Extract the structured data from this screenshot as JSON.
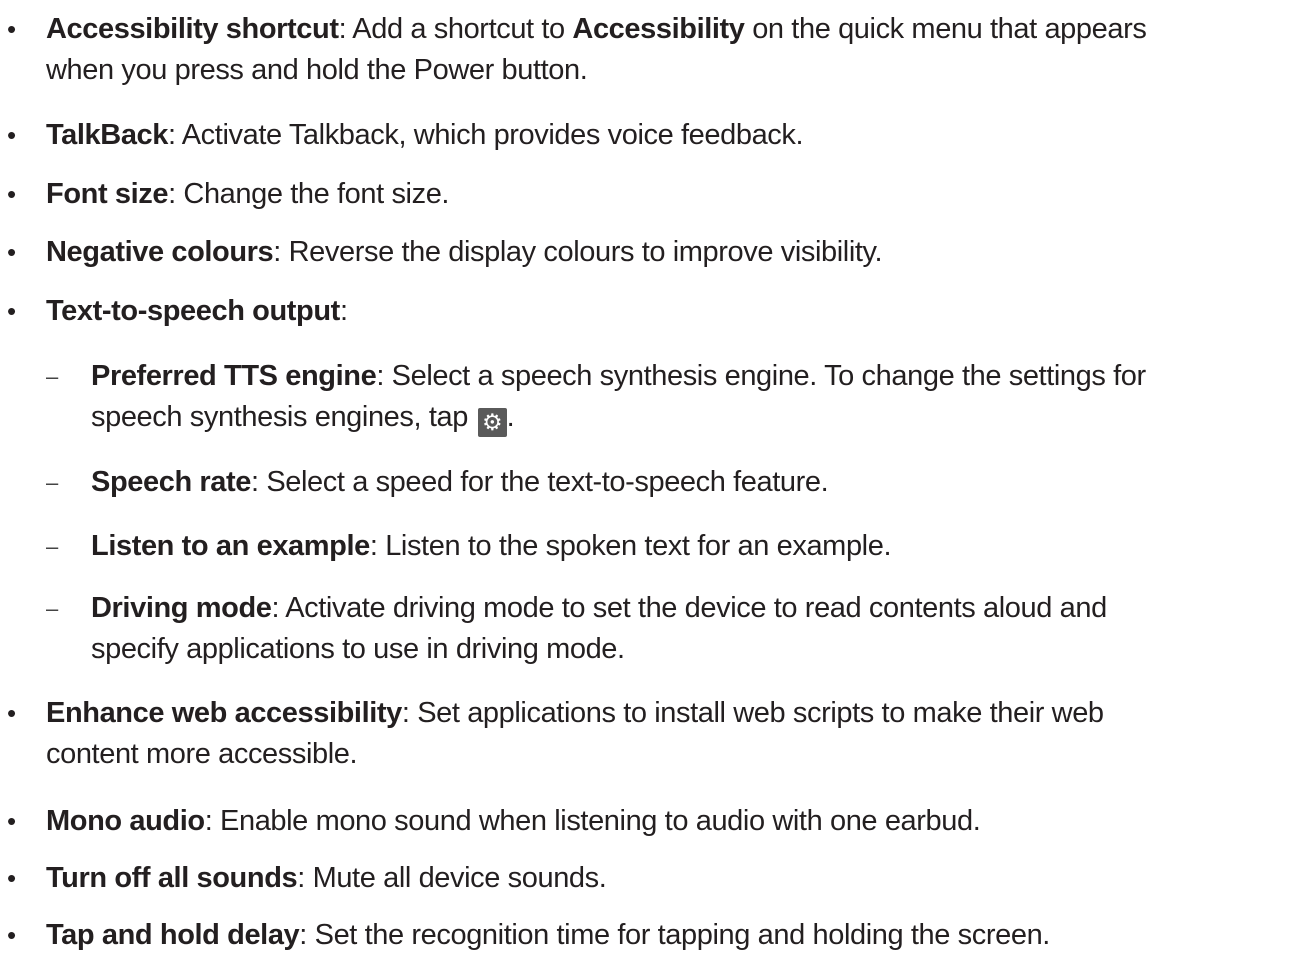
{
  "items": [
    {
      "level": 1,
      "term": "Accessibility shortcut",
      "sep": ":",
      "line1_pre": " Add a shortcut to ",
      "line1_bold": "Accessibility",
      "line1_post": " on the quick menu that appears",
      "line2": "when you press and hold the Power button."
    },
    {
      "level": 1,
      "term": "TalkBack",
      "sep": ":",
      "text": " Activate Talkback, which provides voice feedback."
    },
    {
      "level": 1,
      "term": "Font size",
      "sep": ":",
      "text": " Change the font size."
    },
    {
      "level": 1,
      "term": "Negative colours",
      "sep": ":",
      "text": " Reverse the display colours to improve visibility."
    },
    {
      "level": 1,
      "term": "Text-to-speech output",
      "sep": ":",
      "text": ""
    },
    {
      "level": 2,
      "term": "Preferred TTS engine",
      "sep": ":",
      "line1": " Select a speech synthesis engine. To change the settings for",
      "line2_pre": "speech synthesis engines, tap ",
      "line2_icon": "gear-icon",
      "line2_post": "."
    },
    {
      "level": 2,
      "term": "Speech rate",
      "sep": ":",
      "text": " Select a speed for the text-to-speech feature."
    },
    {
      "level": 2,
      "term": "Listen to an example",
      "sep": ":",
      "text": " Listen to the spoken text for an example."
    },
    {
      "level": 2,
      "term": "Driving mode",
      "sep": ":",
      "line1": " Activate driving mode to set the device to read contents aloud and",
      "line2": "specify applications to use in driving mode."
    },
    {
      "level": 1,
      "term": "Enhance web accessibility",
      "sep": ":",
      "line1": " Set applications to install web scripts to make their web",
      "line2": "content more accessible."
    },
    {
      "level": 1,
      "term": "Mono audio",
      "sep": ":",
      "text": " Enable mono sound when listening to audio with one earbud."
    },
    {
      "level": 1,
      "term": "Turn off all sounds",
      "sep": ":",
      "text": " Mute all device sounds."
    },
    {
      "level": 1,
      "term": "Tap and hold delay",
      "sep": ":",
      "text": " Set the recognition time for tapping and holding the screen."
    }
  ],
  "markers": {
    "bullet": "•",
    "dash": "–"
  },
  "colors": {
    "text": "#231f20",
    "icon_bg": "#5a5a5a"
  }
}
